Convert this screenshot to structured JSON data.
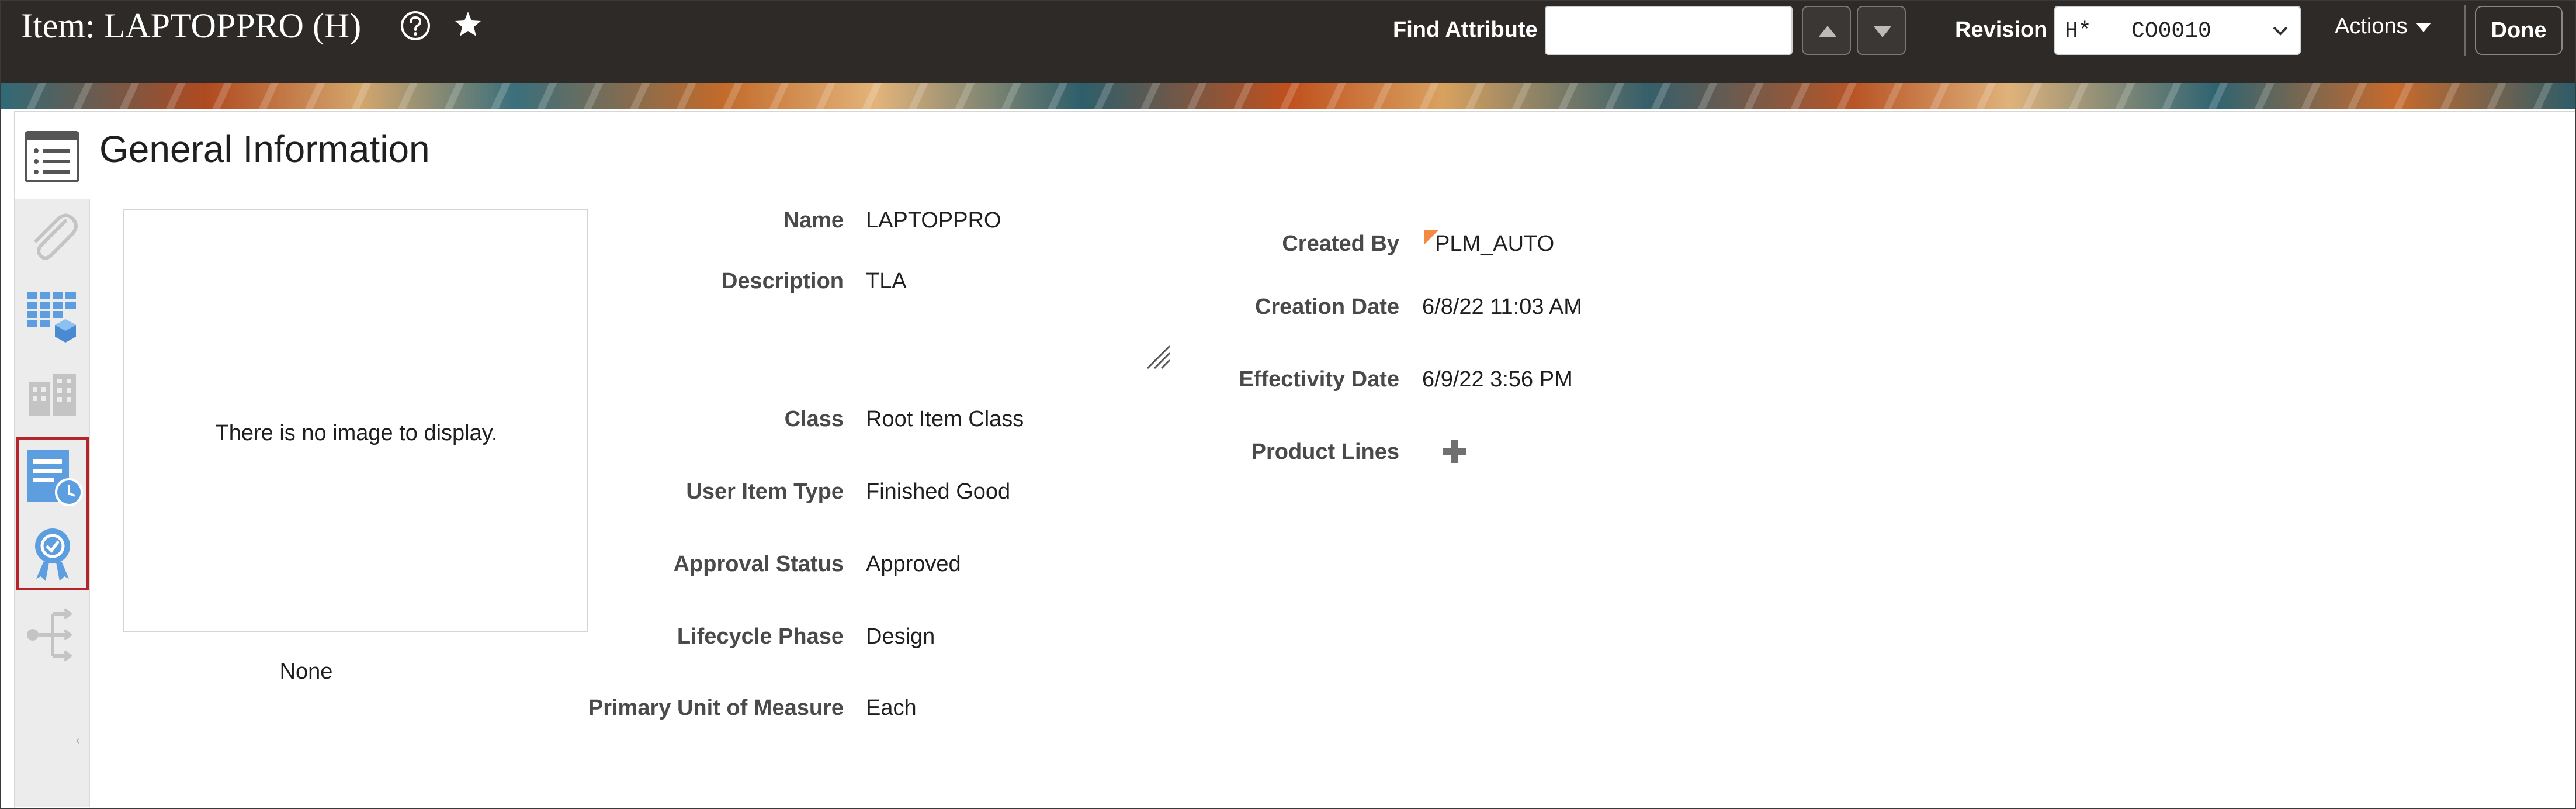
{
  "header": {
    "title": "Item: LAPTOPPRO (H)",
    "help_icon": "help-circle-icon",
    "favorite_icon": "star-icon",
    "find_attribute_label": "Find Attribute",
    "find_attribute_value": "",
    "previous_icon": "triangle-up-icon",
    "next_icon": "triangle-down-icon",
    "revision_label": "Revision",
    "revision_value": "H*   CO0010",
    "actions_label": "Actions",
    "done_label": "Done"
  },
  "sidebar": {
    "items": [
      {
        "icon": "list-document-icon",
        "active": true
      },
      {
        "icon": "paperclip-icon",
        "active": false
      },
      {
        "icon": "grid-cube-icon",
        "active": false
      },
      {
        "icon": "building-icon",
        "active": false
      },
      {
        "icon": "document-clock-icon",
        "active": false,
        "highlighted": true
      },
      {
        "icon": "award-ribbon-icon",
        "active": false,
        "highlighted": true
      },
      {
        "icon": "structure-tree-icon",
        "active": false
      }
    ],
    "highlight_color": "#b3242b"
  },
  "section": {
    "title": "General Information"
  },
  "image_panel": {
    "empty_message": "There is no image to display.",
    "caption": "None"
  },
  "fields_left": [
    {
      "label": "Name",
      "value": "LAPTOPPRO"
    },
    {
      "label": "Description",
      "value": "TLA"
    },
    {
      "label": "Class",
      "value": "Root Item Class"
    },
    {
      "label": "User Item Type",
      "value": "Finished Good"
    },
    {
      "label": "Approval Status",
      "value": "Approved"
    },
    {
      "label": "Lifecycle Phase",
      "value": "Design"
    },
    {
      "label": "Primary Unit of Measure",
      "value": "Each"
    }
  ],
  "fields_right": [
    {
      "label": "Created By",
      "value": "PLM_AUTO"
    },
    {
      "label": "Creation Date",
      "value": "6/8/22 11:03 AM"
    },
    {
      "label": "Effectivity Date",
      "value": "6/9/22 3:56 PM"
    },
    {
      "label": "Product Lines",
      "value": ""
    }
  ],
  "colors": {
    "header_bg": "#2d2a27",
    "accent_blue": "#4a90d9",
    "created_by_flag": "#f28a45"
  }
}
